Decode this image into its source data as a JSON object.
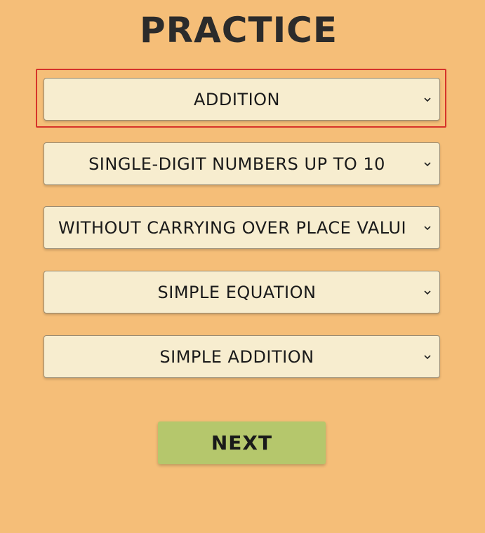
{
  "page": {
    "title": "PRACTICE"
  },
  "selects": [
    {
      "value": "ADDITION"
    },
    {
      "value": "SINGLE-DIGIT NUMBERS UP TO 10"
    },
    {
      "value": "WITHOUT CARRYING OVER PLACE VALUI"
    },
    {
      "value": "SIMPLE EQUATION"
    },
    {
      "value": "SIMPLE ADDITION"
    }
  ],
  "next_button": {
    "label": "NEXT"
  },
  "icons": {
    "dropdown": "chevron-down-icon"
  },
  "colors": {
    "background": "#f5be78",
    "select_bg": "#f7edcf",
    "focus_outline": "#d6332a",
    "next_button_bg": "#b5c76c",
    "title_text": "#2b2b2b"
  }
}
